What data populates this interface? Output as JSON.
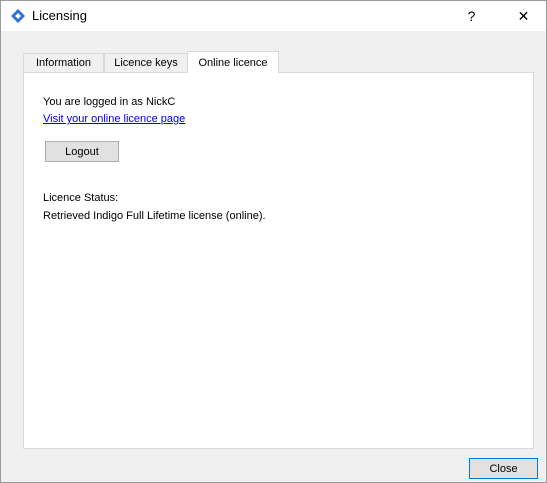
{
  "window": {
    "title": "Licensing",
    "help_label": "?",
    "close_label": "✕",
    "icon": "diamond-icon",
    "accent_color": "#2f6fde"
  },
  "tabs": [
    {
      "label": "Information"
    },
    {
      "label": "Licence keys"
    },
    {
      "label": "Online licence",
      "active": true
    }
  ],
  "online_licence": {
    "logged_in_text": "You are logged in as NickC",
    "visit_link": "Visit your online licence page",
    "logout_button": "Logout",
    "status_label": "Licence Status:",
    "status_value": "Retrieved Indigo Full Lifetime license (online)."
  },
  "footer": {
    "close_button": "Close"
  }
}
